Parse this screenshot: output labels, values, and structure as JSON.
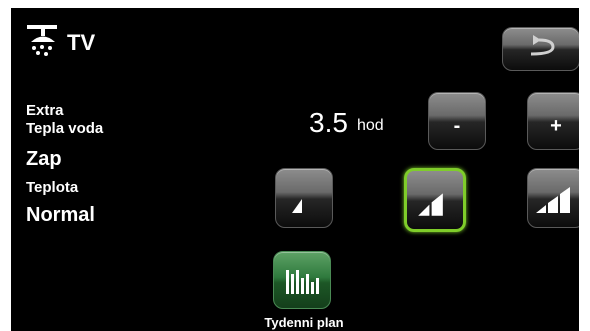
{
  "header": {
    "title": "TV",
    "icon": "shower-icon"
  },
  "nav": {
    "back_icon": "back-arrow-icon"
  },
  "extra_hot_water": {
    "label_line1": "Extra",
    "label_line2": "Tepla voda",
    "state": "Zap",
    "duration_value": "3.5",
    "duration_unit": "hod",
    "minus_label": "-",
    "plus_label": "+"
  },
  "temperature": {
    "label": "Teplota",
    "value": "Normal",
    "levels": [
      "level-1",
      "level-2",
      "level-3"
    ],
    "selected_level": 2
  },
  "weekly_plan": {
    "label": "Tydenni plan",
    "icon": "bar-chart-icon"
  },
  "colors": {
    "screen_bg": "#000000",
    "selected_outline": "#7fcd2a",
    "plan_button": "#2f7a3d"
  }
}
